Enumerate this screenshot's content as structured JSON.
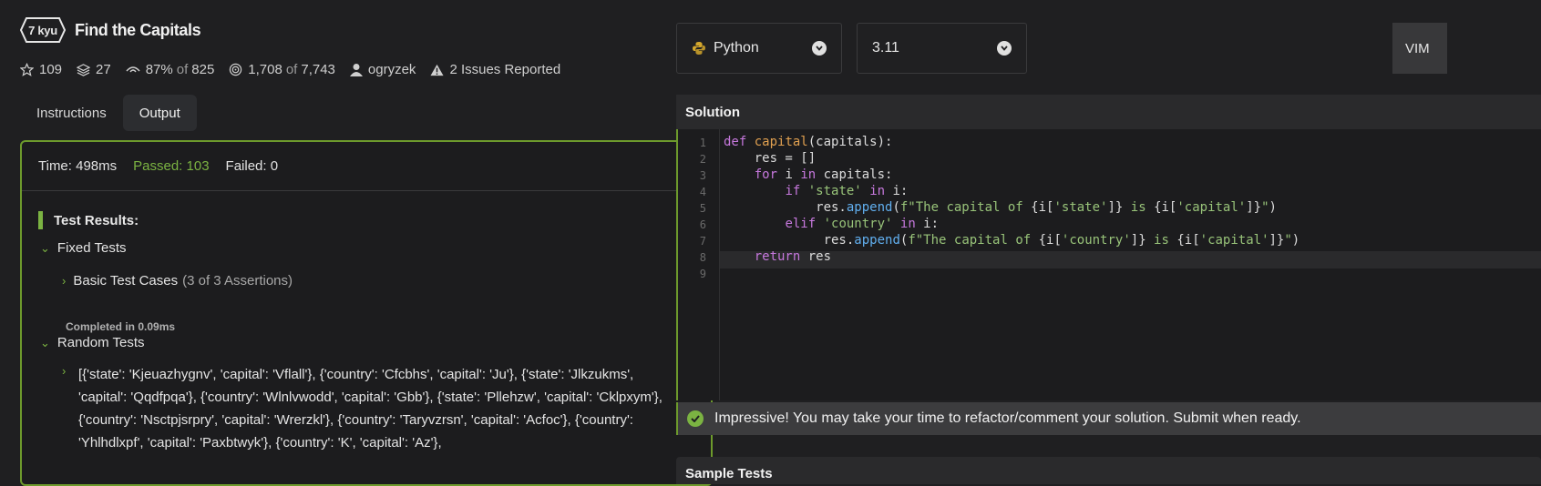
{
  "kata": {
    "rank": "7 kyu",
    "title": "Find the Capitals",
    "stars": "109",
    "collections": "27",
    "satisfaction_pct": "87%",
    "satisfaction_of": "of",
    "satisfaction_votes": "825",
    "completions": "1,708",
    "completions_of": "of",
    "completions_total": "7,743",
    "author": "ogryzek",
    "issues": "2 Issues Reported"
  },
  "tabs": [
    {
      "label": "Instructions",
      "active": false
    },
    {
      "label": "Output",
      "active": true
    }
  ],
  "output": {
    "time": "Time: 498ms",
    "passed": "Passed: 103",
    "failed": "Failed: 0",
    "results_title": "Test Results:",
    "fixed_tests": "Fixed Tests",
    "basic_test_cases": "Basic Test Cases",
    "basic_assertions": "(3 of 3 Assertions)",
    "completed": "Completed in 0.09ms",
    "random_tests": "Random Tests",
    "random_case": "[{'state': 'Kjeuazhygnv', 'capital': 'Vflall'}, {'country': 'Cfcbhs', 'capital': 'Ju'}, {'state': 'Jlkzukms', 'capital': 'Qqdfpqa'}, {'country': 'Wlnlvwodd', 'capital': 'Gbb'}, {'state': 'Pllehzw', 'capital': 'Cklpxym'}, {'country': 'Nsctpjsrpry', 'capital': 'Wrerzkl'}, {'country': 'Taryvzrsn', 'capital': 'Acfoc'}, {'country': 'Yhlhdlxpf', 'capital': 'Paxbtwyk'}, {'country': 'K', 'capital': 'Az'},"
  },
  "editor": {
    "language": "Python",
    "version": "3.11",
    "mode": "VIM",
    "solution_label": "Solution",
    "line_numbers": [
      "1",
      "2",
      "3",
      "4",
      "5",
      "6",
      "7",
      "8",
      "9"
    ],
    "banner": "Impressive! You may take your time to refactor/comment your solution. Submit when ready.",
    "sample_tests_label": "Sample Tests"
  },
  "colors": {
    "accent_green": "#7bb342",
    "border_green": "#6d9a2c",
    "background": "#1f1f21"
  }
}
